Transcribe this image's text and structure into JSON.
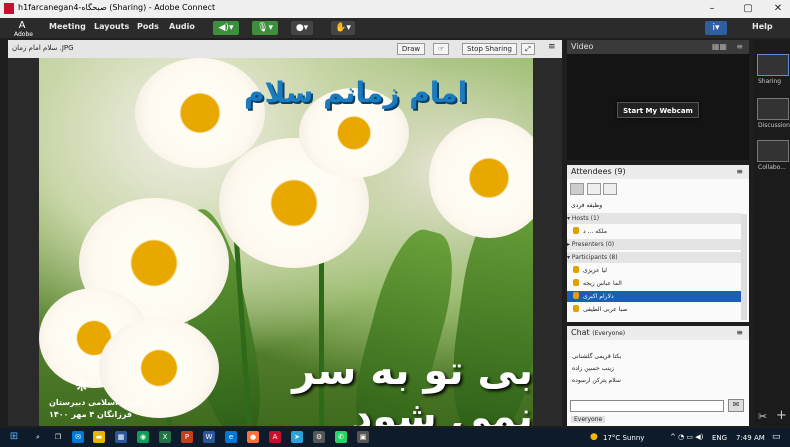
{
  "window": {
    "title": "h1farcanegan4-صبحگاه (Sharing) - Adobe Connect"
  },
  "menubar": {
    "logo_label": "Adobe",
    "items": [
      "Meeting",
      "Layouts",
      "Pods",
      "Audio"
    ],
    "help": "Help"
  },
  "share": {
    "filename": "سلام امام زمان .JPG",
    "draw_label": "Draw",
    "stop_label": "Stop Sharing",
    "menu": "≡"
  },
  "image": {
    "title_text": "امام زمانم سلام",
    "calligraphy": "بی تو به سر نمی شود",
    "org_line1": "انجمن اسلامی دبیرستان",
    "org_line2": "فرزانگان ۴ مهر ۱۴۰۰"
  },
  "video": {
    "title": "Video",
    "webcam_button": "Start My Webcam"
  },
  "attendees": {
    "title": "Attendees",
    "count": "(9)",
    "raise": "وظیفه فردی",
    "hosts_label": "Hosts (1)",
    "hosts": [
      "ملکه ... د"
    ],
    "presenters_label": "Presenters (0)",
    "participants_label": "Participants (8)",
    "participants": [
      "لیا عزیزی",
      "الما عباس زیحه",
      "دلارام اکبری",
      "صبا عربی الطیفی"
    ]
  },
  "chat": {
    "title": "Chat",
    "scope": "(Everyone)",
    "messages": [
      "یکتا قریمی گلشنانی",
      "زینب حسین زاده",
      "سلام پترکن ارسوده"
    ],
    "tab": "Everyone"
  },
  "layouts": {
    "items": [
      "Sharing",
      "Discussion",
      "Collabo..."
    ]
  },
  "taskbar": {
    "weather": "17°C Sunny",
    "lang": "ENG",
    "time": "7:49 AM"
  },
  "colors": {
    "accent": "#1a5fb4",
    "title_blue": "#1b7bbf"
  }
}
